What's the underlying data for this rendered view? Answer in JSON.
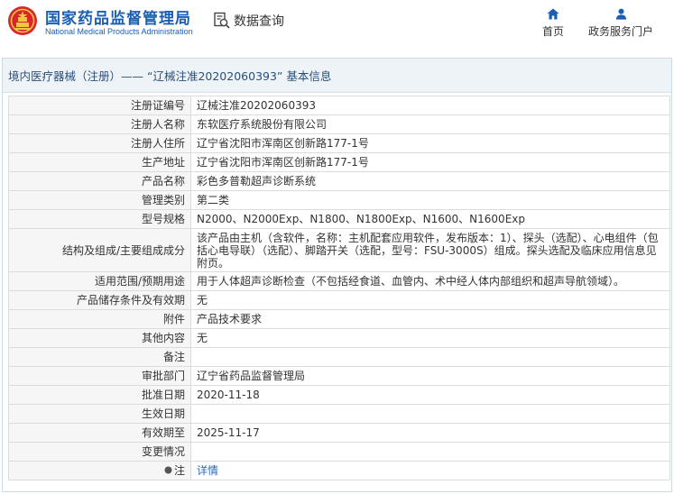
{
  "header": {
    "brand_cn": "国家药品监督管理局",
    "brand_en": "National Medical Products Administration",
    "data_query_label": "数据查询",
    "nav_home_label": "首页",
    "nav_service_label": "政务服务门户"
  },
  "page": {
    "title": "境内医疗器械（注册）——  “辽械注准20202060393” 基本信息"
  },
  "detail": {
    "rows": [
      {
        "label": "注册证编号",
        "value": "辽械注准20202060393"
      },
      {
        "label": "注册人名称",
        "value": "东软医疗系统股份有限公司"
      },
      {
        "label": "注册人住所",
        "value": "辽宁省沈阳市浑南区创新路177-1号"
      },
      {
        "label": "生产地址",
        "value": "辽宁省沈阳市浑南区创新路177-1号"
      },
      {
        "label": "产品名称",
        "value": "彩色多普勒超声诊断系统"
      },
      {
        "label": "管理类别",
        "value": "第二类"
      },
      {
        "label": "型号规格",
        "value": "N2000、N2000Exp、N1800、N1800Exp、N1600、N1600Exp"
      },
      {
        "label": "结构及组成/主要组成成分",
        "value": "该产品由主机（含软件，名称：主机配套应用软件，发布版本：1）、探头（选配）、心电组件（包括心电导联）（选配）、脚踏开关（选配，型号：FSU-3000S）组成。探头选配及临床应用信息见附页。"
      },
      {
        "label": "适用范围/预期用途",
        "value": "用于人体超声诊断检查（不包括经食道、血管内、术中经人体内部组织和超声导航领域）。"
      },
      {
        "label": "产品储存条件及有效期",
        "value": "无"
      },
      {
        "label": "附件",
        "value": "产品技术要求"
      },
      {
        "label": "其他内容",
        "value": "无"
      },
      {
        "label": "备注",
        "value": ""
      },
      {
        "label": "审批部门",
        "value": "辽宁省药品监督管理局"
      },
      {
        "label": "批准日期",
        "value": "2020-11-18"
      },
      {
        "label": "生效日期",
        "value": ""
      },
      {
        "label": "有效期至",
        "value": "2025-11-17"
      },
      {
        "label": "变更情况",
        "value": ""
      }
    ],
    "note_label": "注",
    "note_link": "详情"
  },
  "icons": {
    "logo": "nmpa-logo-icon",
    "data_query": "search-document-icon",
    "home": "home-icon",
    "service": "user-icon",
    "note": "info-dot-icon"
  },
  "colors": {
    "brand_blue": "#1a5fb4",
    "label_bg": "#f6f6f6",
    "title_bar_bg": "#eef3f8",
    "link": "#2a6bb8"
  }
}
